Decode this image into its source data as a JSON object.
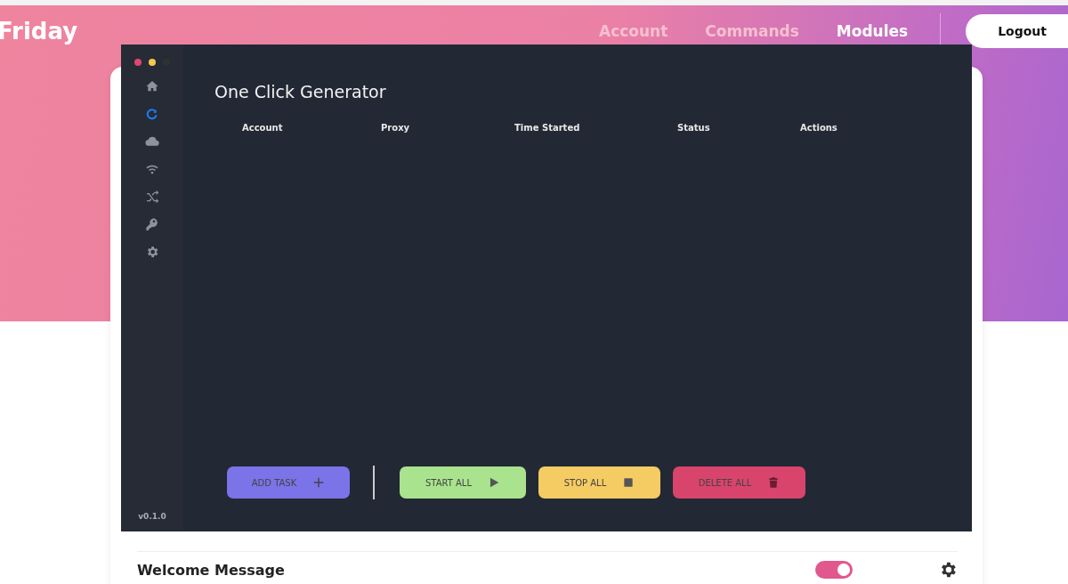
{
  "site": {
    "brand": "Friday",
    "nav": [
      {
        "label": "Account",
        "selected": false
      },
      {
        "label": "Commands",
        "selected": false
      },
      {
        "label": "Modules",
        "selected": true
      }
    ],
    "logout": "Logout"
  },
  "modules": [
    {
      "name": "Welcome Message",
      "enabled": true
    }
  ],
  "app": {
    "sidebar": [
      {
        "selected": false
      },
      {
        "selected": true
      },
      {
        "selected": false
      },
      {
        "selected": false
      },
      {
        "selected": false
      },
      {
        "selected": false
      },
      {
        "selected": false
      }
    ],
    "version": "v0.1.0",
    "title": "One Click Generator",
    "columns": [
      "Account",
      "Proxy",
      "Time Started",
      "Status",
      "Actions"
    ],
    "buttons": [
      {
        "label": "ADD TASK",
        "kind": "add",
        "color": "#7b73e8"
      },
      {
        "label": "START ALL",
        "kind": "start",
        "color": "#a9e38e"
      },
      {
        "label": "STOP ALL",
        "kind": "stop",
        "color": "#f5cb63"
      },
      {
        "label": "DELETE ALL",
        "kind": "delete",
        "color": "#d9446c"
      }
    ]
  }
}
